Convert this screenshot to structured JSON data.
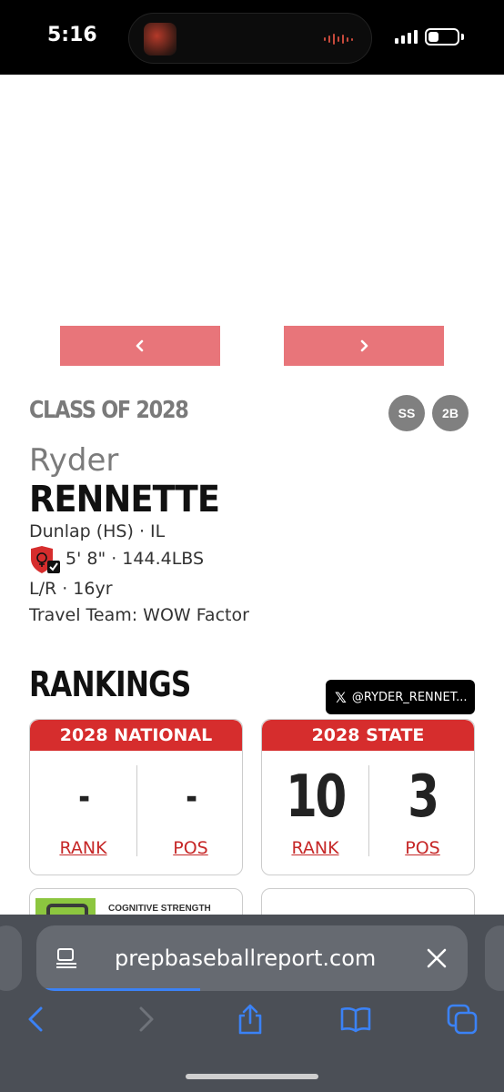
{
  "status_bar": {
    "time": "5:16",
    "battery_level": 0.35
  },
  "carousel": {
    "prev_icon": "chevron-left-icon",
    "next_icon": "chevron-right-icon"
  },
  "player": {
    "class_of": "CLASS OF 2028",
    "positions": [
      "SS",
      "2B"
    ],
    "first_name": "Ryder",
    "last_name": "RENNETTE",
    "school": "Dunlap (HS) · IL",
    "height_weight": "5' 8\" · 144.4LBS",
    "bats_throws_age": "L/R · 16yr",
    "travel_team": "Travel Team: WOW Factor"
  },
  "rankings": {
    "title": "RANKINGS",
    "twitter_handle": "@RYDER_RENNET...",
    "national": {
      "header": "2028 NATIONAL",
      "rank_value": "-",
      "pos_value": "-",
      "rank_label": "RANK",
      "pos_label": "POS"
    },
    "state": {
      "header": "2028 STATE",
      "rank_value": "10",
      "pos_value": "3",
      "rank_label": "RANK",
      "pos_label": "POS"
    }
  },
  "partial_cards": {
    "left_text": "COGNITIVE STRENGTH"
  },
  "browser": {
    "url": "prepbaseballreport.com",
    "load_progress": 0.38
  },
  "colors": {
    "accent_red": "#d62d2d",
    "carousel_pink": "#e8757a",
    "link_blue": "#3b82f6"
  }
}
